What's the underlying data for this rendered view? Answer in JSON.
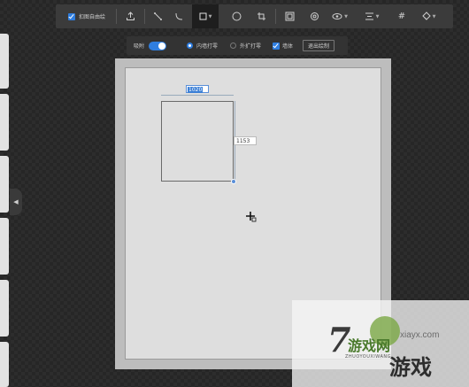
{
  "toolbar": {
    "free_draw_label": "扣图自由绘",
    "tools": [
      "upload",
      "line",
      "arc",
      "rectangle",
      "circle",
      "crop",
      "frame",
      "mask",
      "eye",
      "align",
      "grid",
      "fill"
    ]
  },
  "options": {
    "snap_label": "吸附",
    "inner_label": "内墙打零",
    "outer_label": "外扩打零",
    "wall_label": "墙体",
    "exit_label": "退出绘制"
  },
  "shape": {
    "width_value": "1020",
    "height_value": "1153"
  },
  "watermark": {
    "big_char": "7",
    "brand": "游戏网",
    "site": "xiayx.com",
    "pinyin": "ZHUOYOUXIWANG",
    "game": "游戏"
  },
  "colors": {
    "accent": "#2f7ee0",
    "toolbar_bg": "#3b3b3b",
    "canvas_bg": "#dedede"
  }
}
